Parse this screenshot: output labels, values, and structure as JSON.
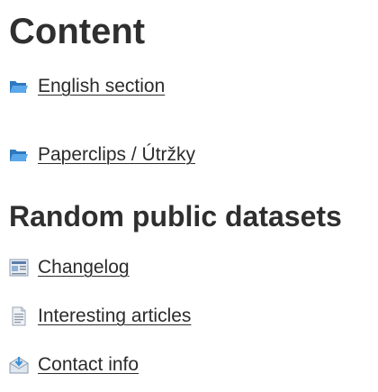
{
  "content": {
    "heading": "Content",
    "links": [
      {
        "label": "English section",
        "icon": "folder-icon"
      },
      {
        "label": "Paperclips / Útržky",
        "icon": "folder-icon"
      }
    ]
  },
  "datasets": {
    "heading": "Random public datasets",
    "links": [
      {
        "label": "Changelog",
        "icon": "newspaper-icon"
      },
      {
        "label": "Interesting articles",
        "icon": "document-icon"
      },
      {
        "label": "Contact info",
        "icon": "incoming-mail-icon"
      }
    ]
  },
  "colors": {
    "text": "#2b2b2b",
    "folder_blue": "#3d8fd6",
    "folder_blue_light": "#6cb4ee"
  }
}
